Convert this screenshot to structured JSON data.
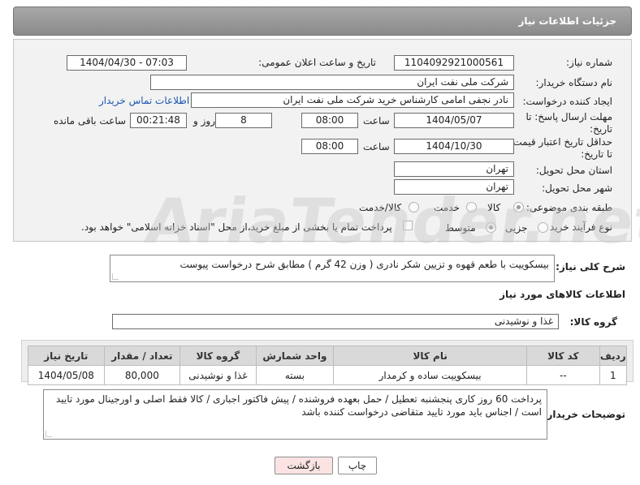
{
  "header": {
    "title": "جزئیات اطلاعات نیاز"
  },
  "form": {
    "need_number_label": "شماره نیاز:",
    "need_number": "1104092921000561",
    "announce_label": "تاریخ و ساعت اعلان عمومی:",
    "announce_value": "1404/04/30 - 07:03",
    "buyer_org_label": "نام دستگاه خریدار:",
    "buyer_org": "شرکت ملی نفت ایران",
    "creator_label": "ایجاد کننده درخواست:",
    "creator": "نادر نجفی امامی کارشناس خرید شرکت ملی نفت ایران",
    "contact_link": "اطلاعات تماس خریدار",
    "deadline_label_1": "مهلت ارسال پاسخ: تا",
    "deadline_label_2": "تاریخ:",
    "deadline_date": "1404/05/07",
    "time_label": "ساعت",
    "deadline_time": "08:00",
    "days_value": "8",
    "days_label": "روز و",
    "remaining_time": "00:21:48",
    "remaining_label": "ساعت باقی مانده",
    "price_label_1": "حداقل تاریخ اعتبار قیمت:",
    "price_label_2": "تا تاریخ:",
    "price_date": "1404/10/30",
    "price_time": "08:00",
    "province_label": "استان محل تحویل:",
    "province": "تهران",
    "city_label": "شهر محل تحویل:",
    "city": "تهران",
    "category_label": "طبقه بندی موضوعی:",
    "category_options": [
      "کالا",
      "خدمت",
      "کالا/خدمت"
    ],
    "process_label": "نوع فرآیند خرید :",
    "process_options": [
      "جزیی",
      "متوسط"
    ],
    "payment_note": "پرداخت تمام یا بخشی از مبلغ خرید،از محل \"اسناد خزانه اسلامی\" خواهد بود."
  },
  "description": {
    "label": "شرح کلی نیاز:",
    "text": "بیسکوییت با طعم قهوه و تزیین شکر نادری ( وزن 42 گرم ) مطابق شرح درخواست پیوست"
  },
  "goods_info": {
    "title": "اطلاعات کالاهای مورد نیاز",
    "group_label": "گروه کالا:",
    "group_value": "غذا و نوشیدنی"
  },
  "table": {
    "headers": [
      "ردیف",
      "کد کالا",
      "نام کالا",
      "واحد شمارش",
      "گروه کالا",
      "تعداد / مقدار",
      "تاریخ نیاز"
    ],
    "rows": [
      [
        "1",
        "--",
        "بیسکوییت ساده و کرمدار",
        "بسته",
        "غذا و نوشیدنی",
        "80,000",
        "1404/05/08"
      ]
    ]
  },
  "buyer_notes": {
    "label": "توضیحات خریدار:",
    "text": "پرداخت 60 روز کاری پنجشنبه تعطیل  / حمل بعهده فروشنده / پیش فاکتور اجباری / کالا فقط اصلی و اورجینال مورد تایید است / اجناس باید مورد تایید متقاضی درخواست کننده باشد"
  },
  "buttons": {
    "print": "چاپ",
    "back": "بازگشت"
  },
  "watermark": "AriaTender.net",
  "colors": {
    "link": "#1a56b0",
    "back_button_bg": "#fbe3e3",
    "print_button_bg": "#ffffff",
    "header_bg": "#999999"
  }
}
